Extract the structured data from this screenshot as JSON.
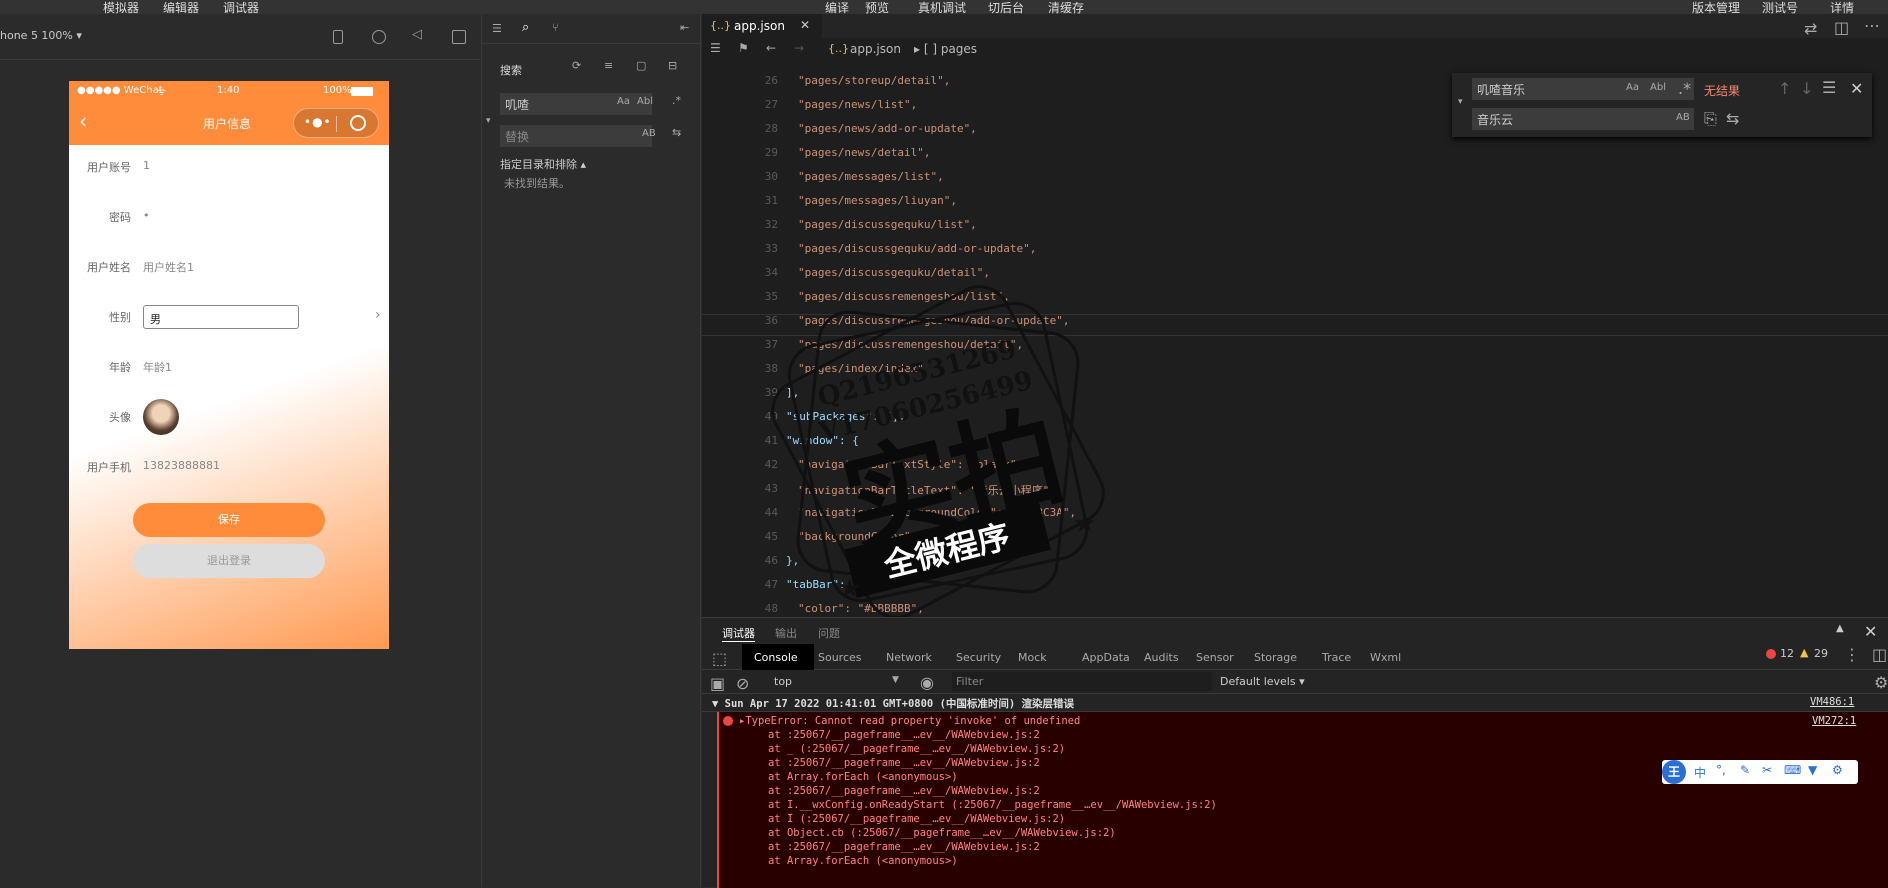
{
  "topmenu": {
    "left": [
      "模拟器",
      "编辑器",
      "调试器"
    ],
    "center": [
      "编译",
      "预览",
      "真机调试",
      "切后台",
      "清缓存"
    ],
    "right": [
      "版本管理",
      "测试号",
      "详情"
    ]
  },
  "simulator": {
    "device_label": "hone 5 100% ▾",
    "status_left": "●●●●● WeChat",
    "status_time": "1:40",
    "status_right": "100%",
    "nav_title": "用户信息",
    "fields": [
      {
        "label": "用户账号",
        "value": "1"
      },
      {
        "label": "密码",
        "value": "•"
      },
      {
        "label": "用户姓名",
        "value": "用户姓名1"
      },
      {
        "label": "性别",
        "value": "男"
      },
      {
        "label": "年龄",
        "value": "年龄1"
      },
      {
        "label": "头像",
        "value": ""
      },
      {
        "label": "用户手机",
        "value": "13823888881"
      }
    ],
    "save_label": "保存",
    "logout_label": "退出登录"
  },
  "search_panel": {
    "title": "搜索",
    "search_value": "叽喳",
    "replace_placeholder": "替换",
    "include_label": "指定目录和排除 ▴",
    "no_results": "未找到结果。"
  },
  "editor": {
    "tab_name": "app.json",
    "crumb_file": "app.json",
    "crumb_path": "▸ [ ] pages",
    "lines": [
      {
        "n": "26",
        "t": "\"pages/storeup/detail\","
      },
      {
        "n": "27",
        "t": "\"pages/news/list\","
      },
      {
        "n": "28",
        "t": "\"pages/news/add-or-update\","
      },
      {
        "n": "29",
        "t": "\"pages/news/detail\","
      },
      {
        "n": "30",
        "t": "\"pages/messages/list\","
      },
      {
        "n": "31",
        "t": "\"pages/messages/liuyan\","
      },
      {
        "n": "32",
        "t": "\"pages/discussgequku/list\","
      },
      {
        "n": "33",
        "t": "\"pages/discussgequku/add-or-update\","
      },
      {
        "n": "34",
        "t": "\"pages/discussgequku/detail\","
      },
      {
        "n": "35",
        "t": "\"pages/discussremengeshou/list\","
      },
      {
        "n": "36",
        "t": "\"pages/discussremengeshou/add-or-update\","
      },
      {
        "n": "37",
        "t": "\"pages/discussremengeshou/detail\","
      },
      {
        "n": "38",
        "t": "\"pages/index/index\""
      },
      {
        "n": "39",
        "t": "],"
      },
      {
        "n": "40",
        "t": "\"subPackages\": [],"
      },
      {
        "n": "41",
        "t": "\"window\": {"
      },
      {
        "n": "42",
        "t": "\"navigationBarTextStyle\": \"black\","
      },
      {
        "n": "43",
        "t": "\"navigationBarTitleText\": \"音乐云小程序\","
      },
      {
        "n": "44",
        "t": "\"navigationBarBackgroundColor\": \"#FF8C3A\","
      },
      {
        "n": "45",
        "t": "\"backgroundColor\": \"#FFFFFF\""
      },
      {
        "n": "46",
        "t": "},"
      },
      {
        "n": "47",
        "t": "\"tabBar\": {"
      },
      {
        "n": "48",
        "t": "\"color\": \"#BBBBBB\","
      }
    ]
  },
  "find_widget": {
    "find_value": "叽喳音乐",
    "no_result": "无结果",
    "replace_value": "音乐云",
    "opt_case": "Aa",
    "opt_word": "Abl",
    "opt_regex": ".*",
    "opt_preserve": "AB"
  },
  "console": {
    "top_tabs": [
      "调试器",
      "输出",
      "问题"
    ],
    "tabs": [
      "Console",
      "Sources",
      "Network",
      "Security",
      "Mock",
      "AppData",
      "Audits",
      "Sensor",
      "Storage",
      "Trace",
      "Wxml"
    ],
    "err_count": "12",
    "warn_count": "29",
    "context": "top",
    "filter_placeholder": "Filter",
    "levels": "Default levels ▾",
    "group_header": "▼ Sun Apr 17 2022 01:41:01 GMT+0800 (中国标准时间) 渲染层错误",
    "group_src": "VM486:1",
    "error_msg": "▸TypeError: Cannot read property 'invoke' of undefined",
    "error_src": "VM272:1",
    "stack": [
      "at :25067/__pageframe__…ev__/WAWebview.js:2",
      "at _ (:25067/__pageframe__…ev__/WAWebview.js:2)",
      "at :25067/__pageframe__…ev__/WAWebview.js:2",
      "at Array.forEach (<anonymous>)",
      "at :25067/__pageframe__…ev__/WAWebview.js:2",
      "at I.__wxConfig.onReadyStart (:25067/__pageframe__…ev__/WAWebview.js:2)",
      "at I (:25067/__pageframe__…ev__/WAWebview.js:2)",
      "at Object.cb (:25067/__pageframe__…ev__/WAWebview.js:2)",
      "at :25067/__pageframe__…ev__/WAWebview.js:2",
      "at Array.forEach (<anonymous>)"
    ]
  },
  "ime_bar": {
    "logo": "王",
    "mode": "中"
  },
  "watermark": {
    "phone1": "Q2196531269",
    "phone2": "V17060256499",
    "main": "实拍",
    "sub": "全微程序"
  },
  "colors": {
    "accent": "#FF8C3A",
    "error_bg": "#290000",
    "string": "#CE9178"
  }
}
